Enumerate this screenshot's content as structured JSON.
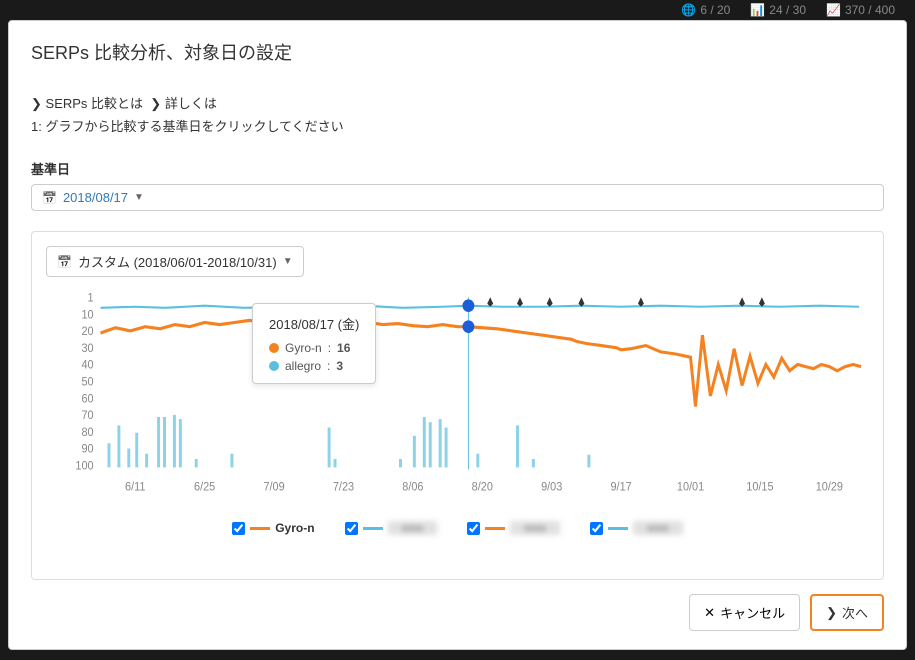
{
  "topbar": {
    "stat1": "6 / 20",
    "stat2": "24 / 30",
    "stat3": "370 / 400"
  },
  "modal": {
    "title": "SERPs 比較分析、対象日の設定",
    "link1": "SERPs 比較とは",
    "link2": "詳しくは",
    "instruction": "1: グラフから比較する基準日をクリックしてください",
    "base_date_label": "基準日",
    "base_date_value": "2018/08/17",
    "range_label": "カスタム (2018/06/01-2018/10/31)"
  },
  "tooltip": {
    "date": "2018/08/17 (金)",
    "series1_name": "Gyro-n",
    "series1_value": "16",
    "series2_name": "allegro",
    "series2_value": "3"
  },
  "legend": {
    "item1": "Gyro-n",
    "item2": "■■■",
    "item3": "■■■",
    "item4": "■■■"
  },
  "footer": {
    "cancel": "キャンセル",
    "next": "次へ"
  },
  "chart_data": {
    "type": "line",
    "ylabel": "",
    "xlabel": "",
    "ylim": [
      100,
      1
    ],
    "y_ticks": [
      1,
      10,
      20,
      30,
      40,
      50,
      60,
      70,
      80,
      90,
      100
    ],
    "x_ticks": [
      "6/11",
      "6/25",
      "7/09",
      "7/23",
      "8/06",
      "8/20",
      "9/03",
      "9/17",
      "10/01",
      "10/15",
      "10/29"
    ],
    "cursor_date": "2018/08/17",
    "series": [
      {
        "name": "Gyro-n",
        "color": "#f58220",
        "values_sample": [
          16,
          14,
          16,
          15,
          13,
          12,
          14,
          13,
          12,
          13,
          14,
          16,
          16,
          16,
          18,
          22,
          26,
          30,
          33,
          30,
          38,
          60,
          25,
          48,
          30,
          55,
          28,
          40,
          38,
          40,
          36,
          38
        ]
      },
      {
        "name": "allegro",
        "color": "#5bc0de",
        "values_sample": [
          4,
          4,
          3,
          4,
          3,
          4,
          3,
          3,
          3,
          4,
          3,
          3,
          4,
          3,
          3,
          4,
          3,
          3,
          4,
          3,
          4
        ]
      }
    ],
    "pins_x": [
      "8/20",
      "8/27",
      "9/03",
      "9/10",
      "9/24",
      "10/12",
      "10/16"
    ]
  }
}
